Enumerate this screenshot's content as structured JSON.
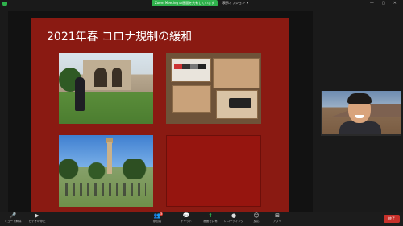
{
  "top_bar": {
    "share_status": "Zoom Meeting の画面を共有しています",
    "view_options": "表示オプション",
    "view_chevron": "▾",
    "window_controls": "— ▢ ✕"
  },
  "slide": {
    "title": "2021年春 コロナ規制の緩和"
  },
  "toolbar": {
    "items": [
      {
        "label": "ミュート解除",
        "icon": "mic-muted-icon",
        "glyph": "🎤"
      },
      {
        "label": "ビデオの停止",
        "icon": "video-icon",
        "glyph": "▶"
      },
      {
        "label": "参加者",
        "icon": "participants-icon",
        "glyph": "👥",
        "badge": "3"
      },
      {
        "label": "チャット",
        "icon": "chat-icon",
        "glyph": "💬"
      },
      {
        "label": "画面を共有",
        "icon": "share-screen-icon",
        "glyph": "⬆"
      },
      {
        "label": "レコーディング",
        "icon": "record-icon",
        "glyph": "●"
      },
      {
        "label": "反応",
        "icon": "reactions-icon",
        "glyph": "☺"
      },
      {
        "label": "アプリ",
        "icon": "apps-icon",
        "glyph": "⊞"
      }
    ],
    "leave_label": "終了"
  },
  "colors": {
    "slide_background": "#8a1a12",
    "share_green": "#2fb24c",
    "leave_red": "#c8302a"
  }
}
